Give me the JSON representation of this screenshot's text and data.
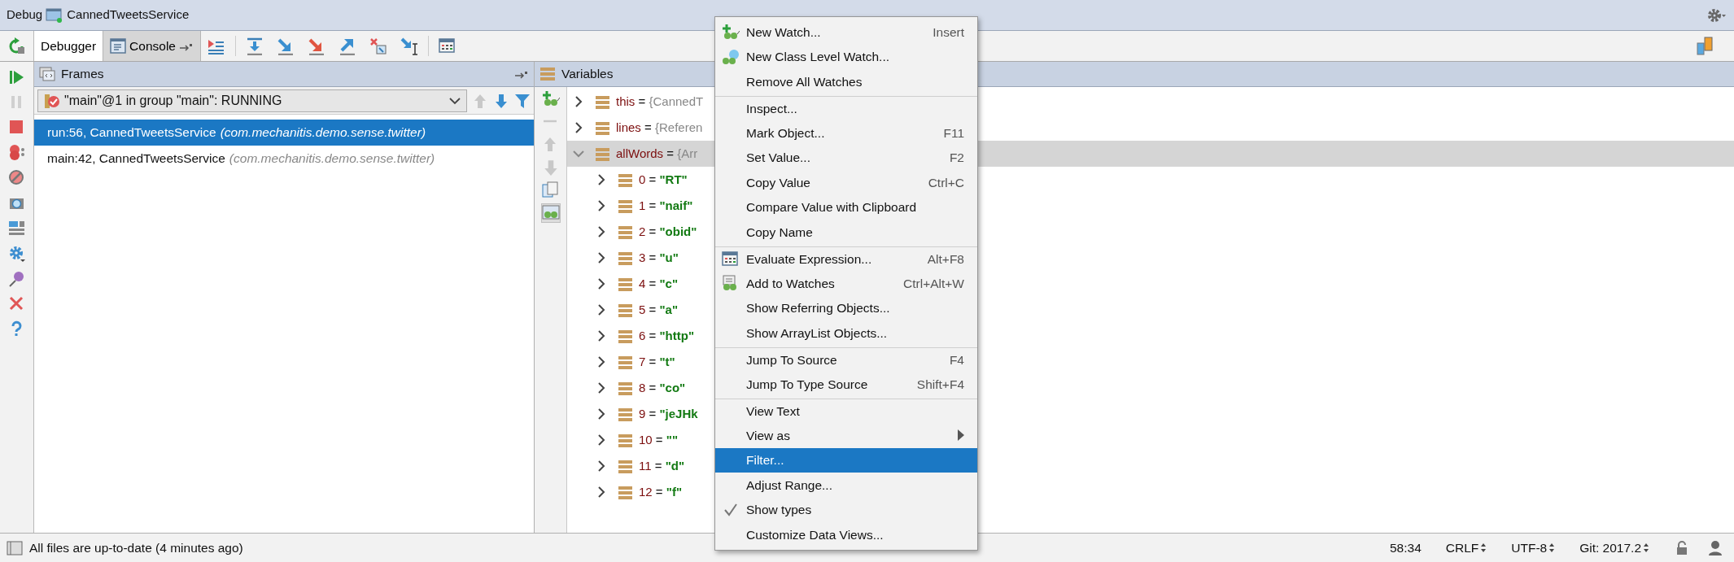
{
  "header": {
    "label": "Debug",
    "session": "CannedTweetsService"
  },
  "tabs": [
    {
      "label": "Debugger",
      "selected": true
    },
    {
      "label": "Console",
      "selected": false
    }
  ],
  "frames": {
    "title": "Frames",
    "thread": "\"main\"@1 in group \"main\": RUNNING",
    "items": [
      {
        "location": "run:56, CannedTweetsService",
        "package": "(com.mechanitis.demo.sense.twitter)",
        "selected": true
      },
      {
        "location": "main:42, CannedTweetsService",
        "package": "(com.mechanitis.demo.sense.twitter)",
        "selected": false
      }
    ]
  },
  "variables": {
    "title": "Variables",
    "items": [
      {
        "name": "this",
        "op": "=",
        "value": "{CannedT",
        "kind": "object",
        "expanded": false,
        "selected": false
      },
      {
        "name": "lines",
        "op": "=",
        "value": "{Referen",
        "kind": "object",
        "expanded": false,
        "selected": false
      },
      {
        "name": "allWords",
        "op": "=",
        "value": "{Arr",
        "kind": "object",
        "expanded": true,
        "selected": true,
        "children": [
          {
            "name": "0",
            "op": "=",
            "value": "\"RT\"",
            "kind": "string"
          },
          {
            "name": "1",
            "op": "=",
            "value": "\"naif\"",
            "kind": "string"
          },
          {
            "name": "2",
            "op": "=",
            "value": "\"obid\"",
            "kind": "string"
          },
          {
            "name": "3",
            "op": "=",
            "value": "\"u\"",
            "kind": "string"
          },
          {
            "name": "4",
            "op": "=",
            "value": "\"c\"",
            "kind": "string"
          },
          {
            "name": "5",
            "op": "=",
            "value": "\"a\"",
            "kind": "string"
          },
          {
            "name": "6",
            "op": "=",
            "value": "\"http\"",
            "kind": "string"
          },
          {
            "name": "7",
            "op": "=",
            "value": "\"t\"",
            "kind": "string"
          },
          {
            "name": "8",
            "op": "=",
            "value": "\"co\"",
            "kind": "string"
          },
          {
            "name": "9",
            "op": "=",
            "value": "\"jeJHk",
            "kind": "string"
          },
          {
            "name": "10",
            "op": "=",
            "value": "\"\"",
            "kind": "string"
          },
          {
            "name": "11",
            "op": "=",
            "value": "\"d\"",
            "kind": "string"
          },
          {
            "name": "12",
            "op": "=",
            "value": "\"f\"",
            "kind": "string"
          }
        ]
      }
    ]
  },
  "context_menu": {
    "items": [
      {
        "label": "New Watch...",
        "shortcut": "Insert",
        "kind": "new-watch",
        "separator_before": false,
        "selected": false,
        "checked": false,
        "submenu": false
      },
      {
        "label": "New Class Level Watch...",
        "kind": "class-watch",
        "separator_before": false,
        "selected": false,
        "checked": false,
        "submenu": false
      },
      {
        "label": "Remove All Watches",
        "kind": "plain",
        "separator_before": false,
        "selected": false,
        "checked": false,
        "submenu": false
      },
      {
        "label": "Inspect...",
        "kind": "plain",
        "separator_before": true,
        "selected": false,
        "checked": false,
        "submenu": false
      },
      {
        "label": "Mark Object...",
        "shortcut": "F11",
        "kind": "plain",
        "separator_before": false,
        "selected": false,
        "checked": false,
        "submenu": false
      },
      {
        "label": "Set Value...",
        "shortcut": "F2",
        "kind": "plain",
        "separator_before": false,
        "selected": false,
        "checked": false,
        "submenu": false
      },
      {
        "label": "Copy Value",
        "shortcut": "Ctrl+C",
        "kind": "plain",
        "separator_before": false,
        "selected": false,
        "checked": false,
        "submenu": false
      },
      {
        "label": "Compare Value with Clipboard",
        "kind": "plain",
        "separator_before": false,
        "selected": false,
        "checked": false,
        "submenu": false
      },
      {
        "label": "Copy Name",
        "kind": "plain",
        "separator_before": false,
        "selected": false,
        "checked": false,
        "submenu": false
      },
      {
        "label": "Evaluate Expression...",
        "shortcut": "Alt+F8",
        "kind": "evaluate",
        "separator_before": true,
        "selected": false,
        "checked": false,
        "submenu": false
      },
      {
        "label": "Add to Watches",
        "shortcut": "Ctrl+Alt+W",
        "kind": "add-watch",
        "separator_before": false,
        "selected": false,
        "checked": false,
        "submenu": false
      },
      {
        "label": "Show Referring Objects...",
        "kind": "plain",
        "separator_before": false,
        "selected": false,
        "checked": false,
        "submenu": false
      },
      {
        "label": "Show ArrayList Objects...",
        "kind": "plain",
        "separator_before": false,
        "selected": false,
        "checked": false,
        "submenu": false
      },
      {
        "label": "Jump To Source",
        "shortcut": "F4",
        "kind": "plain",
        "separator_before": true,
        "selected": false,
        "checked": false,
        "submenu": false
      },
      {
        "label": "Jump To Type Source",
        "shortcut": "Shift+F4",
        "kind": "plain",
        "separator_before": false,
        "selected": false,
        "checked": false,
        "submenu": false
      },
      {
        "label": "View Text",
        "kind": "plain",
        "separator_before": true,
        "selected": false,
        "checked": false,
        "submenu": false
      },
      {
        "label": "View as",
        "kind": "plain",
        "separator_before": false,
        "selected": false,
        "checked": false,
        "submenu": true
      },
      {
        "label": "Filter...",
        "kind": "plain",
        "separator_before": false,
        "selected": true,
        "checked": false,
        "submenu": false
      },
      {
        "label": "Adjust Range...",
        "kind": "plain",
        "separator_before": false,
        "selected": false,
        "checked": false,
        "submenu": false
      },
      {
        "label": "Show types",
        "kind": "plain",
        "separator_before": false,
        "selected": false,
        "checked": true,
        "submenu": false
      },
      {
        "label": "Customize Data Views...",
        "kind": "plain",
        "separator_before": false,
        "selected": false,
        "checked": false,
        "submenu": false
      }
    ]
  },
  "status_bar": {
    "message": "All files are up-to-date (4 minutes ago)",
    "position": "58:34",
    "line_separator": "CRLF",
    "encoding": "UTF-8",
    "branch": "Git: 2017.2"
  }
}
